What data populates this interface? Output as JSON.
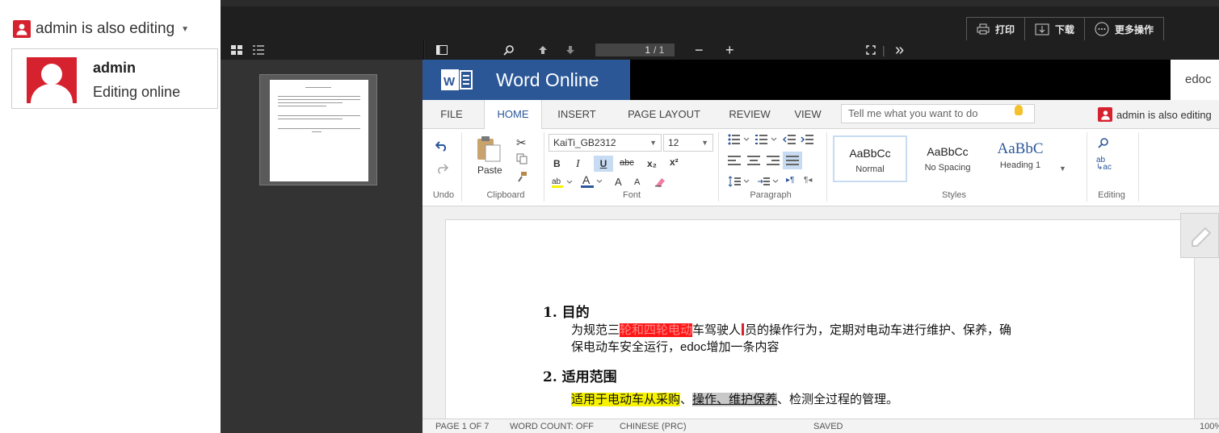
{
  "presence": {
    "header_label": "admin is also editing",
    "user_name": "admin",
    "user_status": "Editing online"
  },
  "viewer_toolbar": {
    "print_label": "打印",
    "download_label": "下载",
    "more_label": "更多操作",
    "page_current": "1",
    "page_total": "/ 1",
    "zoom_out": "−",
    "zoom_in": "+",
    "more_glyph": "»"
  },
  "word": {
    "app_title": "Word Online",
    "doc_name": "edoc",
    "tabs": [
      "FILE",
      "HOME",
      "INSERT",
      "PAGE LAYOUT",
      "REVIEW",
      "VIEW"
    ],
    "active_tab": "HOME",
    "tell_me_placeholder": "Tell me what you want to do",
    "presence_label": "admin is also editing",
    "ribbon": {
      "undo_group": "Undo",
      "clipboard_group": "Clipboard",
      "paste_label": "Paste",
      "font_group": "Font",
      "font_name": "KaiTi_GB2312",
      "font_size": "12",
      "paragraph_group": "Paragraph",
      "styles_group": "Styles",
      "editing_group": "Editing",
      "styles": [
        {
          "sample": "AaBbCc",
          "name": "Normal"
        },
        {
          "sample": "AaBbCc",
          "name": "No Spacing"
        },
        {
          "sample": "AaBbC",
          "name": "Heading 1"
        }
      ],
      "bold": "B",
      "italic": "I",
      "underline": "U",
      "strike": "abc",
      "subscript": "x₂",
      "superscript": "x²",
      "grow": "A",
      "shrink": "A"
    },
    "document": {
      "heading1": "1. 目的",
      "p1_before": "为规范三",
      "p1_highlight": "轮和四轮电动",
      "p1_after_a": "车驾驶人",
      "p1_after_b": "员的操作行为，定期对电动车进行维护、保养，确",
      "p1_line2": "保电动车安全运行，edoc增加一条内容",
      "heading2": "2. 适用范围",
      "p2_yellow": "适用于电动车从采购",
      "p2_sep": "、",
      "p2_grey": "操作、维护保养",
      "p2_rest": "、检测全过程的管理。"
    },
    "status": {
      "page": "PAGE 1 OF 7",
      "word_count": "WORD COUNT: OFF",
      "language": "CHINESE (PRC)",
      "save_state": "SAVED",
      "zoom": "100%"
    }
  },
  "colors": {
    "word_blue": "#2b5797",
    "presence_red": "#d6222f",
    "highlight_red": "#ff1616",
    "highlight_yellow": "#f6f200"
  }
}
